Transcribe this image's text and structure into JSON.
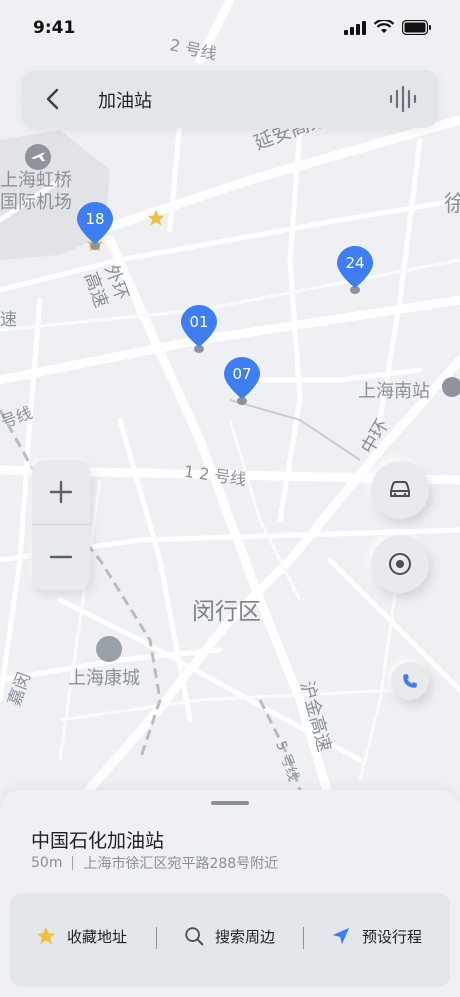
{
  "status_bar": {
    "time": "9:41"
  },
  "search": {
    "title": "加油站"
  },
  "map_labels": {
    "airport": "上海虹桥\n国际机场",
    "yanan": "延安高架路",
    "waihuan": "外环\n高速",
    "shanghai_south": "上海南站",
    "line_12": "1 2 号线",
    "zhonghuan": "中环",
    "minhang": "闵行区",
    "kangcheng": "上海康城",
    "hujin": "沪金高速",
    "line_5": "5 号线",
    "top_line": "2 号线",
    "left_su": "速",
    "left_hao": "号线",
    "right_xu": "徐",
    "left_edge": "嘉闵"
  },
  "pins": [
    {
      "id": "18"
    },
    {
      "id": "24"
    },
    {
      "id": "01"
    },
    {
      "id": "07"
    }
  ],
  "place": {
    "name": "中国石化加油站",
    "distance": "50m",
    "address": "上海市徐汇区宛平路288号附近"
  },
  "actions": [
    {
      "label": "收藏地址",
      "icon": "star-icon"
    },
    {
      "label": "搜索周边",
      "icon": "search-icon"
    },
    {
      "label": "预设行程",
      "icon": "navigation-arrow-icon"
    }
  ],
  "colors": {
    "pin": "#3e7ef0",
    "star": "#f0c045",
    "accent": "#3e7ef0"
  }
}
